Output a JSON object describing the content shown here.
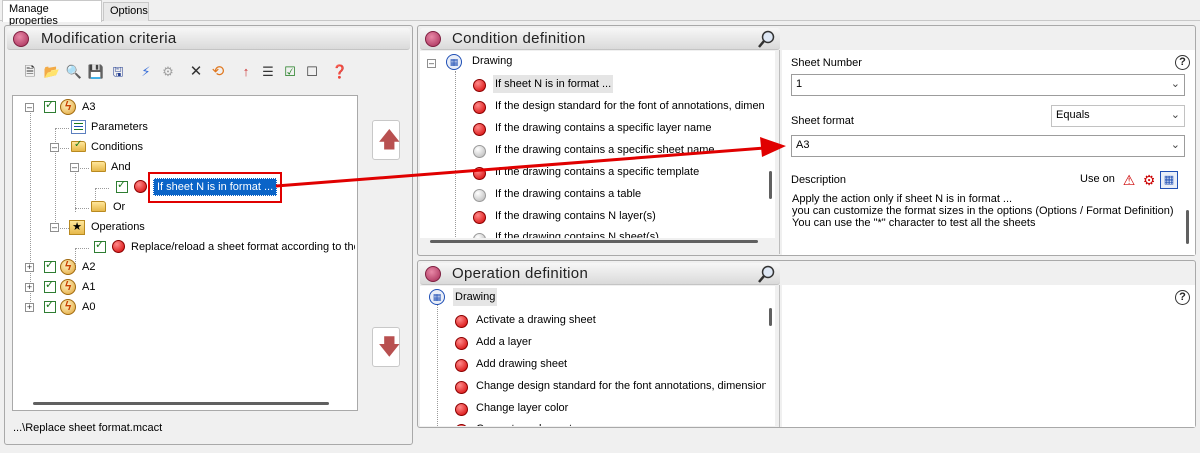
{
  "tabs": [
    {
      "label": "Manage properties",
      "active": true
    },
    {
      "label": "Options",
      "active": false
    }
  ],
  "left_panel": {
    "title": "Modification criteria",
    "toolbar_icons": [
      "new-file-icon",
      "open-folder-icon",
      "search-file-icon",
      "save-icon",
      "save-as-icon",
      "run-icon",
      "gear-disabled-icon",
      "delete-icon",
      "refresh-icon",
      "insert-tree-icon",
      "tree-structure-icon",
      "check-all-icon",
      "uncheck-all-icon",
      "help-icon"
    ],
    "tree": {
      "root_a3": "A3",
      "parameters": "Parameters",
      "conditions": "Conditions",
      "and": "And",
      "selected_condition": "If sheet N is in format ...",
      "or": "Or",
      "operations": "Operations",
      "operation_item": "Replace/reload a sheet format according to the fo",
      "a2": "A2",
      "a1": "A1",
      "a0": "A0"
    },
    "file_path": "...\\Replace sheet format.mcact"
  },
  "condition_panel": {
    "title": "Condition definition",
    "root": "Drawing",
    "items": [
      {
        "label": "If sheet N is in format ...",
        "status": "red",
        "selected": true
      },
      {
        "label": "If the design standard for the font of annotations, dimensio",
        "status": "red"
      },
      {
        "label": "If the drawing contains a specific layer name",
        "status": "red"
      },
      {
        "label": "If the drawing contains a specific sheet name",
        "status": "grey"
      },
      {
        "label": "If the drawing contains a specific template",
        "status": "red"
      },
      {
        "label": "If the drawing contains a table",
        "status": "grey"
      },
      {
        "label": "If the drawing contains N layer(s)",
        "status": "red"
      },
      {
        "label": "If the drawing contains N sheet(s)",
        "status": "grey"
      }
    ],
    "sheet_number_label": "Sheet Number",
    "sheet_number_value": "1",
    "compare_value": "Equals",
    "sheet_format_label": "Sheet format",
    "sheet_format_value": "A3",
    "description_label": "Description",
    "use_on_label": "Use on",
    "description_lines": [
      "Apply the action only if sheet N is in format ...",
      "you can customize the format sizes in the options (Options / Format Definition)",
      "You can use the \"*\" character to test all the sheets"
    ]
  },
  "operation_panel": {
    "title": "Operation definition",
    "root": "Drawing",
    "items": [
      "Activate a drawing sheet",
      "Add a layer",
      "Add drawing sheet",
      "Change design standard for the font annotations, dimensions",
      "Change layer color",
      "Convert an element"
    ]
  },
  "colors": {
    "selection": "#0a64c8",
    "callout_red": "#e00000",
    "header_gradient_top": "#f7f7f7",
    "header_gradient_bottom": "#dadada"
  }
}
